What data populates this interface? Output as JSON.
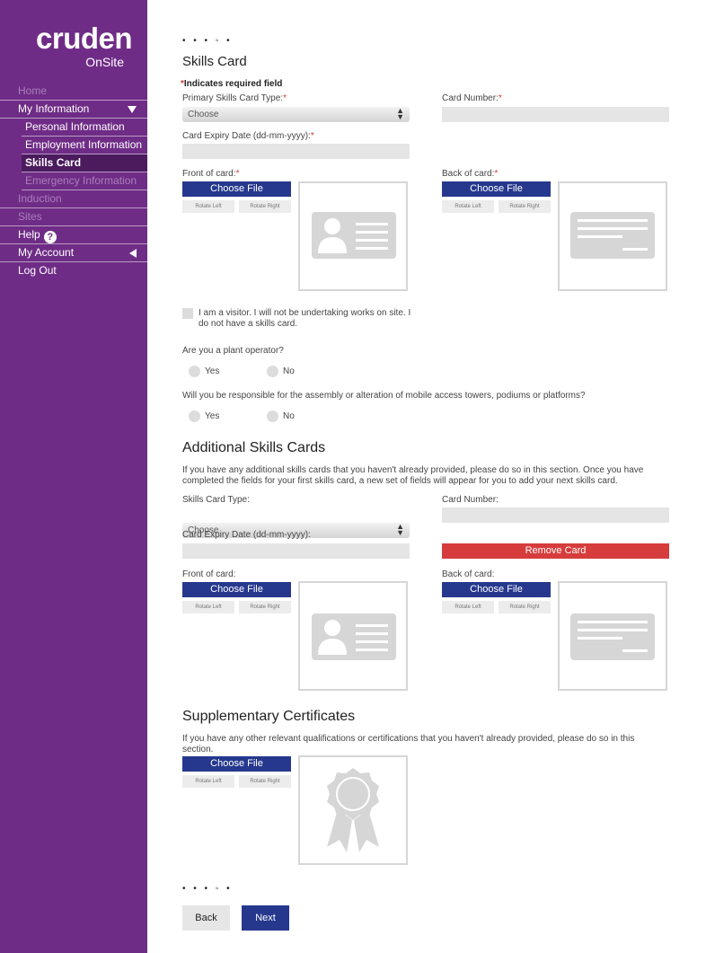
{
  "sidebar": {
    "logo": "cruden",
    "logo_sub": "OnSite",
    "items": {
      "home": "Home",
      "my_information": "My Information",
      "personal_information": "Personal Information",
      "employment_information": "Employment Information",
      "skills_card": "Skills Card",
      "emergency_information": "Emergency Information",
      "induction": "Induction",
      "sites": "Sites",
      "help": "Help",
      "help_badge": "?",
      "my_account": "My Account",
      "log_out": "Log Out"
    }
  },
  "progress_dots": "• • • ◦ •",
  "skills_card": {
    "title": "Skills Card",
    "required_note": "Indicates required field",
    "required_star": "*",
    "primary_type_label": "Primary Skills Card Type:",
    "primary_type_value": "Choose",
    "card_number_label": "Card Number:",
    "card_number_value": "",
    "expiry_label": "Card Expiry Date (dd-mm-yyyy):",
    "expiry_value": "",
    "front_label": "Front of card:",
    "back_label": "Back of card:",
    "choose_file": "Choose File",
    "rotate_left": "Rotate Left",
    "rotate_right": "Rotate Right",
    "visitor_text": "I am a visitor. I will not be undertaking works on site. I do not have a skills card.",
    "plant_question": "Are you a plant operator?",
    "towers_question": "Will you be responsible for the assembly or alteration of mobile access towers, podiums or platforms?",
    "yes": "Yes",
    "no": "No"
  },
  "additional": {
    "title": "Additional Skills Cards",
    "description": "If you have any additional skills cards that you haven't already provided, please do so in this section. Once you have completed the fields for your first skills card, a new set of fields will appear for you to add your next skills card.",
    "type_label": "Skills Card Type:",
    "type_value": "Choose",
    "card_number_label": "Card Number:",
    "expiry_label": "Card Expiry Date (dd-mm-yyyy):",
    "remove_card": "Remove Card",
    "front_label": "Front of card:",
    "back_label": "Back of card:"
  },
  "supplementary": {
    "title": "Supplementary Certificates",
    "description": "If you have any other relevant qualifications or certifications that you haven't already provided, please do so in this section."
  },
  "nav_buttons": {
    "back": "Back",
    "next": "Next"
  },
  "colors": {
    "sidebar": "#6f2c86",
    "primary": "#26388e",
    "danger": "#d63c3c"
  }
}
